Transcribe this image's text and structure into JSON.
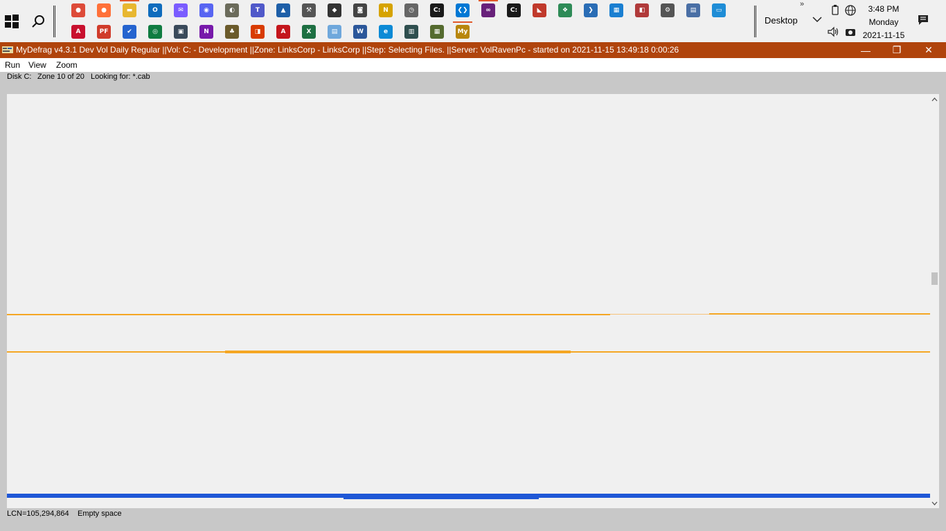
{
  "taskbar": {
    "desktop_label": "Desktop",
    "clock": {
      "time": "3:48 PM",
      "day": "Monday",
      "date": "2021-11-15"
    },
    "row1_icons": [
      {
        "name": "chrome-icon",
        "color": "#dd4b39",
        "glyph": "●"
      },
      {
        "name": "firefox-icon",
        "color": "#ff7139",
        "glyph": "●"
      },
      {
        "name": "file-explorer-icon",
        "color": "#e8b730",
        "glyph": "▬"
      },
      {
        "name": "outlook-icon",
        "color": "#0f6cbd",
        "glyph": "O"
      },
      {
        "name": "messenger-icon",
        "color": "#7a5cff",
        "glyph": "✉"
      },
      {
        "name": "discord-icon",
        "color": "#5865f2",
        "glyph": "◉"
      },
      {
        "name": "gimp-icon",
        "color": "#6b6b5b",
        "glyph": "◐"
      },
      {
        "name": "teams-icon",
        "color": "#5059c9",
        "glyph": "T"
      },
      {
        "name": "photos-icon",
        "color": "#1e5fa8",
        "glyph": "▲"
      },
      {
        "name": "tool-icon",
        "color": "#555555",
        "glyph": "⚒"
      },
      {
        "name": "settings-tool-icon",
        "color": "#333333",
        "glyph": "◆"
      },
      {
        "name": "camera-icon",
        "color": "#444444",
        "glyph": "◙"
      },
      {
        "name": "notepad-icon",
        "color": "#d6a300",
        "glyph": "N"
      },
      {
        "name": "clock-icon",
        "color": "#666666",
        "glyph": "◷"
      },
      {
        "name": "cmd-icon",
        "color": "#1a1a1a",
        "glyph": "C:"
      },
      {
        "name": "vscode-icon",
        "color": "#0078d4",
        "glyph": "❮❯"
      },
      {
        "name": "visual-studio-icon",
        "color": "#68217a",
        "glyph": "∞"
      },
      {
        "name": "terminal-icon",
        "color": "#1a1a1a",
        "glyph": "C:"
      },
      {
        "name": "bookmark-icon",
        "color": "#c0392b",
        "glyph": "◣"
      },
      {
        "name": "windows-tool-icon",
        "color": "#2e8b57",
        "glyph": "❖"
      },
      {
        "name": "powershell-icon",
        "color": "#2a6db5",
        "glyph": "❯"
      },
      {
        "name": "network-icon",
        "color": "#1a7fd1",
        "glyph": "▦"
      },
      {
        "name": "remote-icon",
        "color": "#b03a3a",
        "glyph": "◧"
      },
      {
        "name": "gear-icon",
        "color": "#555555",
        "glyph": "⚙"
      },
      {
        "name": "server-manager-icon",
        "color": "#4a6fa5",
        "glyph": "▤"
      },
      {
        "name": "remote-desktop-icon",
        "color": "#1f8dd6",
        "glyph": "▭"
      }
    ],
    "row2_icons": [
      {
        "name": "amd-icon",
        "color": "#c8102e",
        "glyph": "A"
      },
      {
        "name": "pdf-icon",
        "color": "#d03b2a",
        "glyph": "PF"
      },
      {
        "name": "todo-icon",
        "color": "#2564cf",
        "glyph": "✔"
      },
      {
        "name": "green-app-icon",
        "color": "#107c41",
        "glyph": "◎"
      },
      {
        "name": "display-icon",
        "color": "#3a4a5a",
        "glyph": "▣"
      },
      {
        "name": "onenote-icon",
        "color": "#7719aa",
        "glyph": "N"
      },
      {
        "name": "palm-icon",
        "color": "#6b5b2b",
        "glyph": "♣"
      },
      {
        "name": "office-icon",
        "color": "#d83b01",
        "glyph": "◨"
      },
      {
        "name": "acrobat-icon",
        "color": "#c4161c",
        "glyph": "A"
      },
      {
        "name": "excel-icon",
        "color": "#1d6f42",
        "glyph": "X"
      },
      {
        "name": "notepad2-icon",
        "color": "#6fa8dc",
        "glyph": "▤"
      },
      {
        "name": "word-icon",
        "color": "#2b579a",
        "glyph": "W"
      },
      {
        "name": "edge-icon",
        "color": "#0c8ad6",
        "glyph": "e"
      },
      {
        "name": "video-icon",
        "color": "#2f4f4f",
        "glyph": "▥"
      },
      {
        "name": "calc-icon",
        "color": "#556b2f",
        "glyph": "▦"
      },
      {
        "name": "mydefrag-icon",
        "color": "#b8860b",
        "glyph": "My"
      }
    ]
  },
  "window": {
    "title": "MyDefrag v4.3.1    Dev Vol Daily Regular ||Vol: C: - Development ||Zone: LinksCorp - LinksCorp ||Step: Selecting Files. ||Server: VolRavenPc -  started on 2021-11-15 13:49:18 0:00:26",
    "minimize": "—",
    "restore": "❐",
    "close": "✕"
  },
  "menu": {
    "run": "Run",
    "view": "View",
    "zoom": "Zoom"
  },
  "status": {
    "disk": "Disk C:",
    "zone": "Zone 10 of 20",
    "looking": "Looking for: *.cab",
    "lcn": "LCN=105,294,864",
    "state": "Empty space"
  },
  "colors": {
    "orange": "#f5a623",
    "blue": "#1f57d6",
    "titlebar": "#b0440c"
  }
}
